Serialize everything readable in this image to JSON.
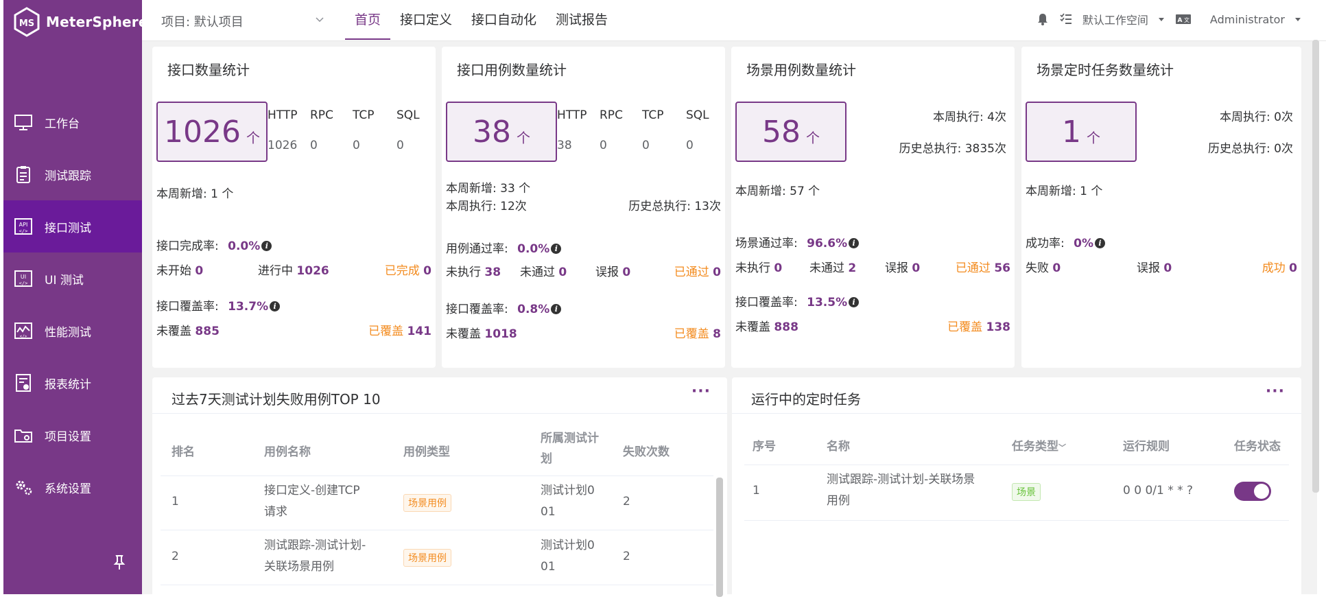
{
  "app": {
    "name": "MeterSphere"
  },
  "sidebar": {
    "items": [
      {
        "label": "工作台",
        "icon": "monitor-icon"
      },
      {
        "label": "测试跟踪",
        "icon": "clipboard-icon"
      },
      {
        "label": "接口测试",
        "icon": "api-icon",
        "active": true
      },
      {
        "label": "UI 测试",
        "icon": "ui-icon"
      },
      {
        "label": "性能测试",
        "icon": "performance-icon"
      },
      {
        "label": "报表统计",
        "icon": "report-icon"
      },
      {
        "label": "项目设置",
        "icon": "folder-icon"
      },
      {
        "label": "系统设置",
        "icon": "gear-icon"
      }
    ]
  },
  "header": {
    "project_label": "项目: 默认项目",
    "tabs": [
      "首页",
      "接口定义",
      "接口自动化",
      "测试报告"
    ],
    "active_tab": "首页",
    "workspace": "默认工作空间",
    "user": "Administrator"
  },
  "cards": {
    "api_count": {
      "title": "接口数量统计",
      "total": "1026",
      "unit": "个",
      "protocols": [
        {
          "name": "HTTP",
          "value": "1026"
        },
        {
          "name": "RPC",
          "value": "0"
        },
        {
          "name": "TCP",
          "value": "0"
        },
        {
          "name": "SQL",
          "value": "0"
        }
      ],
      "week_new": "本周新增: 1 个",
      "completion_label": "接口完成率:",
      "completion_rate": "0.0%",
      "not_started_label": "未开始",
      "not_started": "0",
      "in_progress_label": "进行中",
      "in_progress": "1026",
      "completed_label": "已完成",
      "completed": "0",
      "coverage_label": "接口覆盖率:",
      "coverage_rate": "13.7%",
      "uncovered_label": "未覆盖",
      "uncovered": "885",
      "covered_label": "已覆盖",
      "covered": "141"
    },
    "case_count": {
      "title": "接口用例数量统计",
      "total": "38",
      "unit": "个",
      "protocols": [
        {
          "name": "HTTP",
          "value": "38"
        },
        {
          "name": "RPC",
          "value": "0"
        },
        {
          "name": "TCP",
          "value": "0"
        },
        {
          "name": "SQL",
          "value": "0"
        }
      ],
      "week_new": "本周新增: 33 个",
      "week_exec": "本周执行: 12次",
      "history_exec": "历史总执行: 13次",
      "pass_label": "用例通过率:",
      "pass_rate": "0.0%",
      "not_exec_label": "未执行",
      "not_exec": "38",
      "failed_label": "未通过",
      "failed": "0",
      "false_label": "误报",
      "false_alarm": "0",
      "passed_label": "已通过",
      "passed": "0",
      "coverage_label": "接口覆盖率:",
      "coverage_rate": "0.8%",
      "uncovered_label": "未覆盖",
      "uncovered": "1018",
      "covered_label": "已覆盖",
      "covered": "8"
    },
    "scenario_count": {
      "title": "场景用例数量统计",
      "total": "58",
      "unit": "个",
      "week_exec": "本周执行: 4次",
      "history_exec": "历史总执行: 3835次",
      "week_new": "本周新增: 57 个",
      "pass_label": "场景通过率:",
      "pass_rate": "96.6%",
      "not_exec_label": "未执行",
      "not_exec": "0",
      "failed_label": "未通过",
      "failed": "2",
      "false_label": "误报",
      "false_alarm": "0",
      "passed_label": "已通过",
      "passed": "56",
      "coverage_label": "接口覆盖率:",
      "coverage_rate": "13.5%",
      "uncovered_label": "未覆盖",
      "uncovered": "888",
      "covered_label": "已覆盖",
      "covered": "138"
    },
    "schedule_count": {
      "title": "场景定时任务数量统计",
      "total": "1",
      "unit": "个",
      "week_exec": "本周执行: 0次",
      "history_exec": "历史总执行: 0次",
      "week_new": "本周新增: 1 个",
      "success_label": "成功率:",
      "success_rate": "0%",
      "fail_label": "失败",
      "fail": "0",
      "false_label": "误报",
      "false_alarm": "0",
      "ok_label": "成功",
      "ok": "0"
    }
  },
  "top10": {
    "title": "过去7天测试计划失败用例TOP 10",
    "more": "···",
    "columns": [
      "排名",
      "用例名称",
      "用例类型",
      "所属测试计划",
      "失败次数"
    ],
    "rows": [
      {
        "rank": "1",
        "name_l1": "接口定义-创建TCP",
        "name_l2": "请求",
        "type": "场景用例",
        "plan_l1": "测试计划0",
        "plan_l2": "01",
        "count": "2"
      },
      {
        "rank": "2",
        "name_l1": "测试跟踪-测试计划-",
        "name_l2": "关联场景用例",
        "type": "场景用例",
        "plan_l1": "测试计划0",
        "plan_l2": "01",
        "count": "2"
      }
    ]
  },
  "schedule": {
    "title": "运行中的定时任务",
    "more": "···",
    "columns": [
      "序号",
      "名称",
      "任务类型",
      "运行规则",
      "任务状态"
    ],
    "rows": [
      {
        "index": "1",
        "name_l1": "测试跟踪-测试计划-关联场景",
        "name_l2": "用例",
        "type": "场景",
        "rule": "0 0 0/1 * * ?",
        "enabled": true
      }
    ]
  },
  "colors": {
    "brand": "#783887",
    "orange": "#f38c20",
    "green": "#67c23a"
  }
}
